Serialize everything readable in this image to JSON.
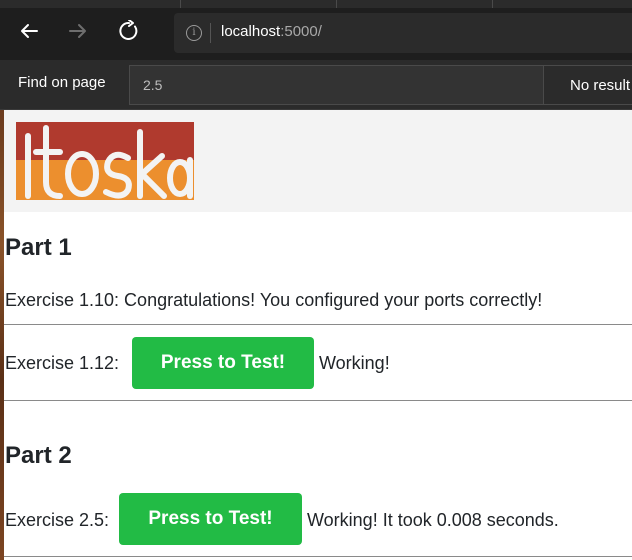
{
  "browser": {
    "back_icon": "arrow-left-icon",
    "forward_icon": "arrow-right-icon",
    "reload_icon": "reload-icon",
    "info_icon": "info-icon",
    "url_host": "localhost",
    "url_port": ":5000/"
  },
  "findbar": {
    "label": "Find on page",
    "query": "2.5",
    "result": "No result"
  },
  "page": {
    "logo_text": "itoska",
    "colors": {
      "logo_top": "#b03a2e",
      "logo_bottom": "#ec8f2e",
      "button": "#22bb45"
    },
    "part1": {
      "heading": "Part 1",
      "ex_110": "Exercise 1.10: Congratulations! You configured your ports correctly!",
      "ex_112_label": "Exercise 1.12:",
      "ex_112_button": "Press to Test!",
      "ex_112_status": "Working!"
    },
    "part2": {
      "heading": "Part 2",
      "ex_25_label": "Exercise 2.5:",
      "ex_25_button": "Press to Test!",
      "ex_25_status": "Working! It took 0.008 seconds."
    }
  }
}
